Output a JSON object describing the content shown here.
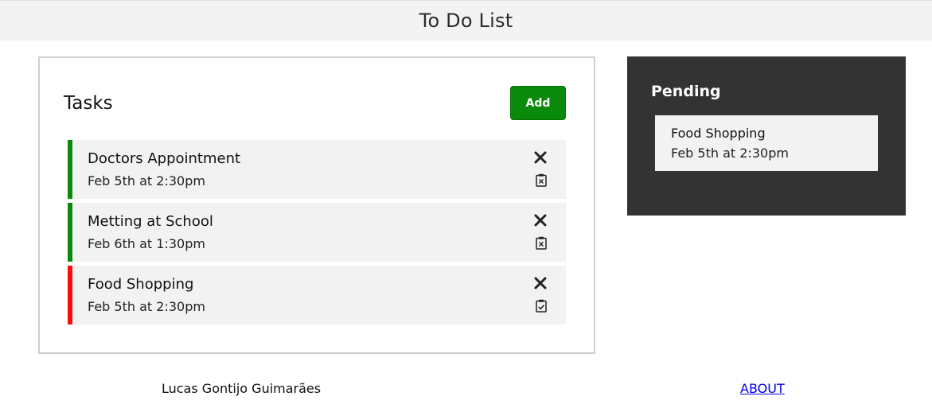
{
  "header": {
    "title": "To Do List"
  },
  "tasks_panel": {
    "title": "Tasks",
    "add_label": "Add",
    "tasks": [
      {
        "title": "Doctors Appointment",
        "date": "Feb 5th at 2:30pm",
        "status_color": "#0a8a0a",
        "clip_icon": "clipboard-x-icon"
      },
      {
        "title": "Metting at School",
        "date": "Feb 6th at 1:30pm",
        "status_color": "#0a8a0a",
        "clip_icon": "clipboard-x-icon"
      },
      {
        "title": "Food Shopping",
        "date": "Feb 5th at 2:30pm",
        "status_color": "#ff0a0a",
        "clip_icon": "clipboard-check-icon"
      }
    ]
  },
  "pending_panel": {
    "title": "Pending",
    "items": [
      {
        "title": "Food Shopping",
        "date": "Feb 5th at 2:30pm"
      }
    ]
  },
  "footer": {
    "author": "Lucas Gontijo Guimarães",
    "about_label": "ABOUT"
  },
  "colors": {
    "add_button": "#0a8a0a",
    "pending_background": "#333333",
    "done": "#0a8a0a",
    "pending": "#ff0a0a"
  }
}
